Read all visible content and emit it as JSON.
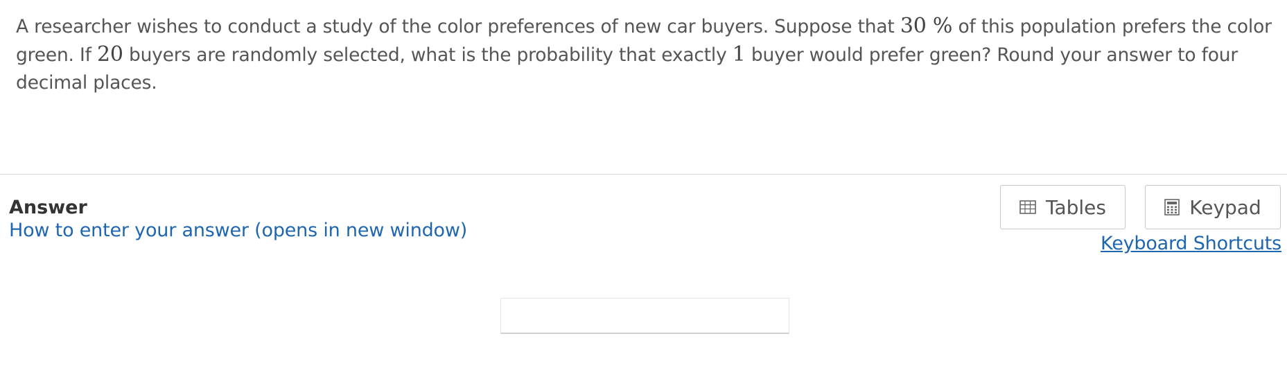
{
  "question": {
    "part1": "A researcher wishes to conduct a study of the color preferences of new car buyers. Suppose that ",
    "percent_value": "30 %",
    "part2": " of this population prefers the color green. If ",
    "sample_size": "20",
    "part3": " buyers are randomly selected, what is the probability that exactly ",
    "exact_count": "1",
    "part4": " buyer would prefer green? Round your answer to four decimal places."
  },
  "answer": {
    "label": "Answer",
    "help_link": "How to enter your answer (opens in new window)",
    "input_value": "",
    "input_placeholder": ""
  },
  "tools": {
    "tables_label": "Tables",
    "tables_icon": "table-grid-icon",
    "keypad_label": "Keypad",
    "keypad_icon": "calculator-icon",
    "shortcuts_label": "Keyboard Shortcuts"
  },
  "colors": {
    "link": "#1f66b0",
    "text": "#555555",
    "divider": "#d6d6d6"
  }
}
